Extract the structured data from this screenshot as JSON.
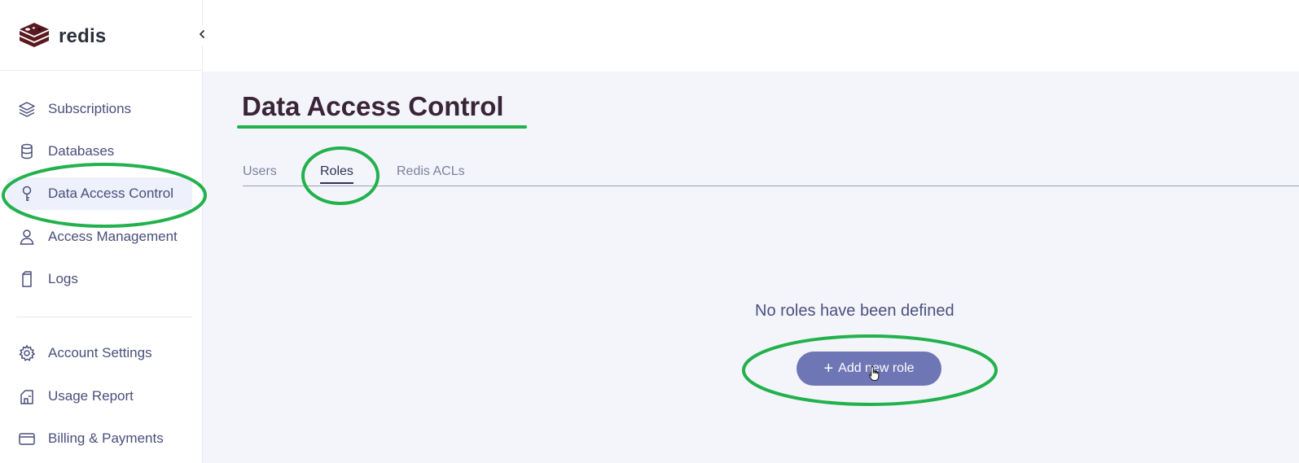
{
  "brand": {
    "name": "redis"
  },
  "sidebar": {
    "collapse_icon": "chevron-left-icon",
    "items": [
      {
        "label": "Subscriptions",
        "icon": "layers-icon"
      },
      {
        "label": "Databases",
        "icon": "database-icon"
      },
      {
        "label": "Data Access Control",
        "icon": "key-icon",
        "active": true
      },
      {
        "label": "Access Management",
        "icon": "user-icon"
      },
      {
        "label": "Logs",
        "icon": "log-icon"
      },
      {
        "label": "Account Settings",
        "icon": "gear-icon"
      },
      {
        "label": "Usage Report",
        "icon": "report-icon"
      },
      {
        "label": "Billing & Payments",
        "icon": "card-icon"
      }
    ]
  },
  "page": {
    "title": "Data Access Control"
  },
  "tabs": [
    {
      "label": "Users",
      "active": false
    },
    {
      "label": "Roles",
      "active": true
    },
    {
      "label": "Redis ACLs",
      "active": false
    }
  ],
  "empty_state": {
    "message": "No roles have been defined",
    "button_label": "Add new role",
    "button_icon": "plus-icon"
  },
  "colors": {
    "annotation": "#22b14c",
    "button": "#6f76b5",
    "title": "#3a2438",
    "nav_text": "#4a4f7a",
    "active_bg": "#eef0fb",
    "main_bg": "#f4f5fa"
  }
}
